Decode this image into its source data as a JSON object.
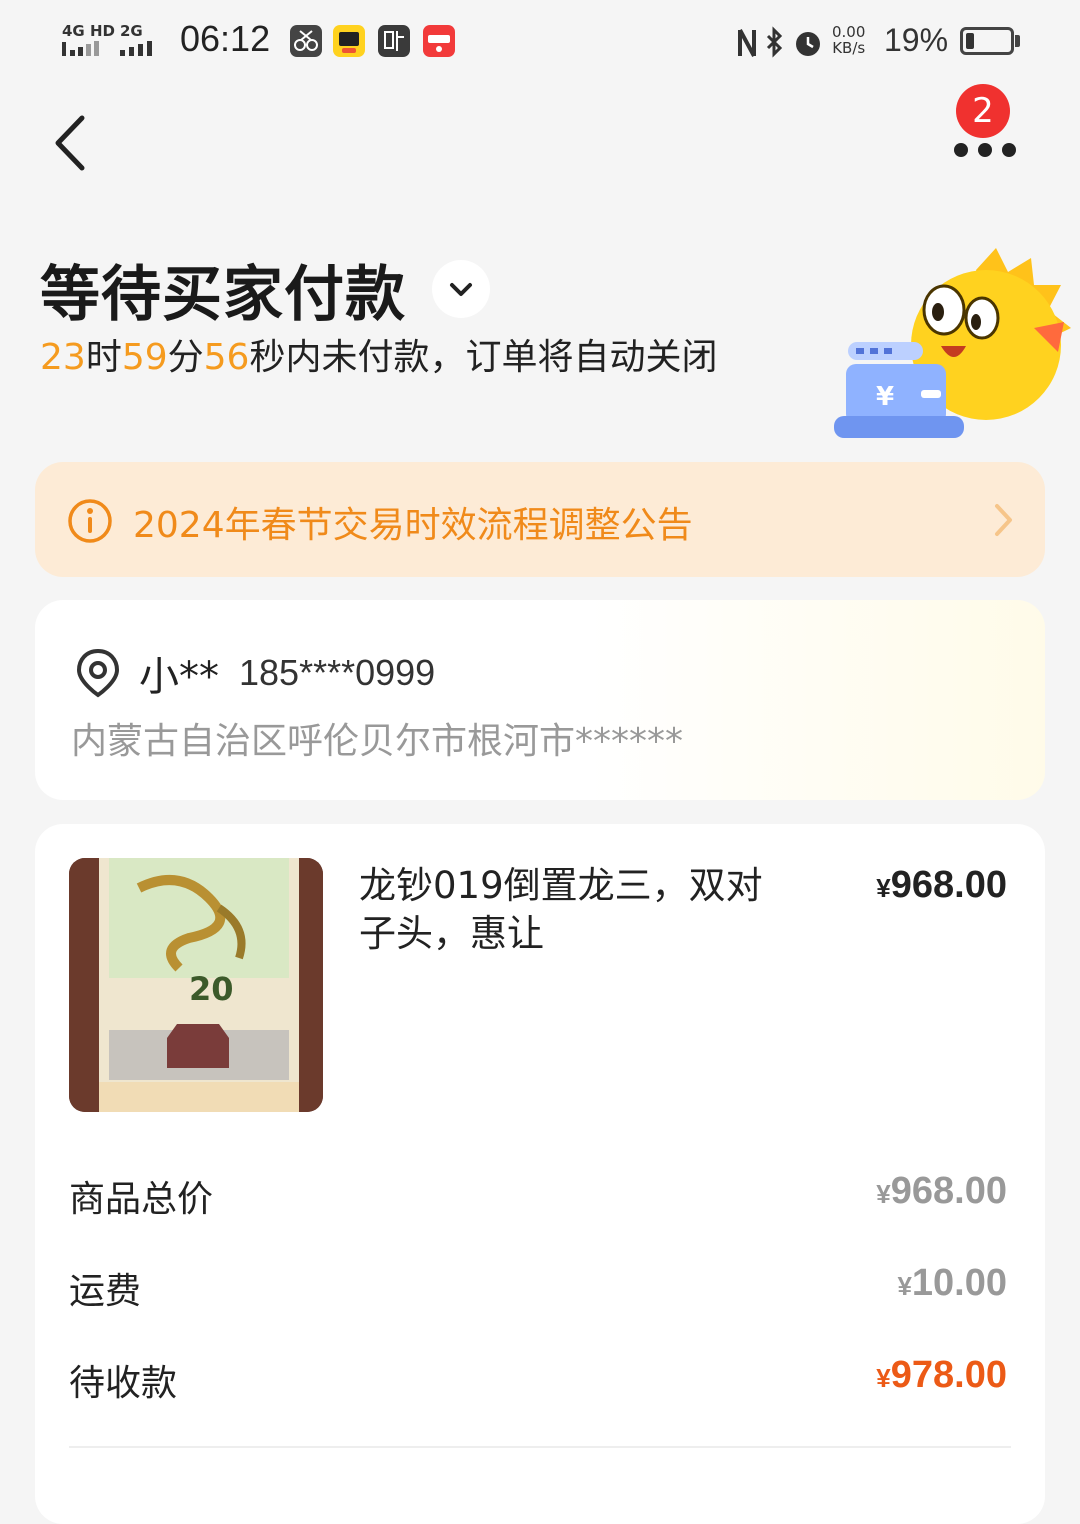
{
  "status_bar": {
    "net1": "4G HD",
    "net2": "2G",
    "time": "06:12",
    "speed_value": "0.00",
    "speed_unit": "KB/s",
    "battery_pct": "19%",
    "battery_level": 0.19,
    "app_icons": [
      "scissors-app-icon",
      "xianyu-app-icon",
      "tie-app-icon",
      "xiaohongshu-app-icon"
    ]
  },
  "header": {
    "badge": "2"
  },
  "order_status": {
    "title": "等待买家付款",
    "hours": "23",
    "h_unit": "时",
    "minutes": "59",
    "m_unit": "分",
    "seconds": "56",
    "tail": "秒内未付款，订单将自动关闭"
  },
  "notice": {
    "text": "2024年春节交易时效流程调整公告"
  },
  "address": {
    "name": "小**",
    "phone": "185****0999",
    "line": "内蒙古自治区呼伦贝尔市根河市******"
  },
  "product": {
    "title": "龙钞019倒置龙三，双对子头，惠让",
    "price_symbol": "¥",
    "price": "968.00",
    "note_number": "20"
  },
  "summary": {
    "rows": [
      {
        "label": "商品总价",
        "symbol": "¥",
        "value": "968.00"
      },
      {
        "label": "运费",
        "symbol": "¥",
        "value": "10.00"
      },
      {
        "label": "待收款",
        "symbol": "¥",
        "value": "978.00"
      }
    ]
  },
  "colors": {
    "accent_orange": "#f59b1f",
    "notice_bg": "#fdebd6",
    "due_red": "#ec5a16",
    "badge_red": "#f0312f"
  }
}
